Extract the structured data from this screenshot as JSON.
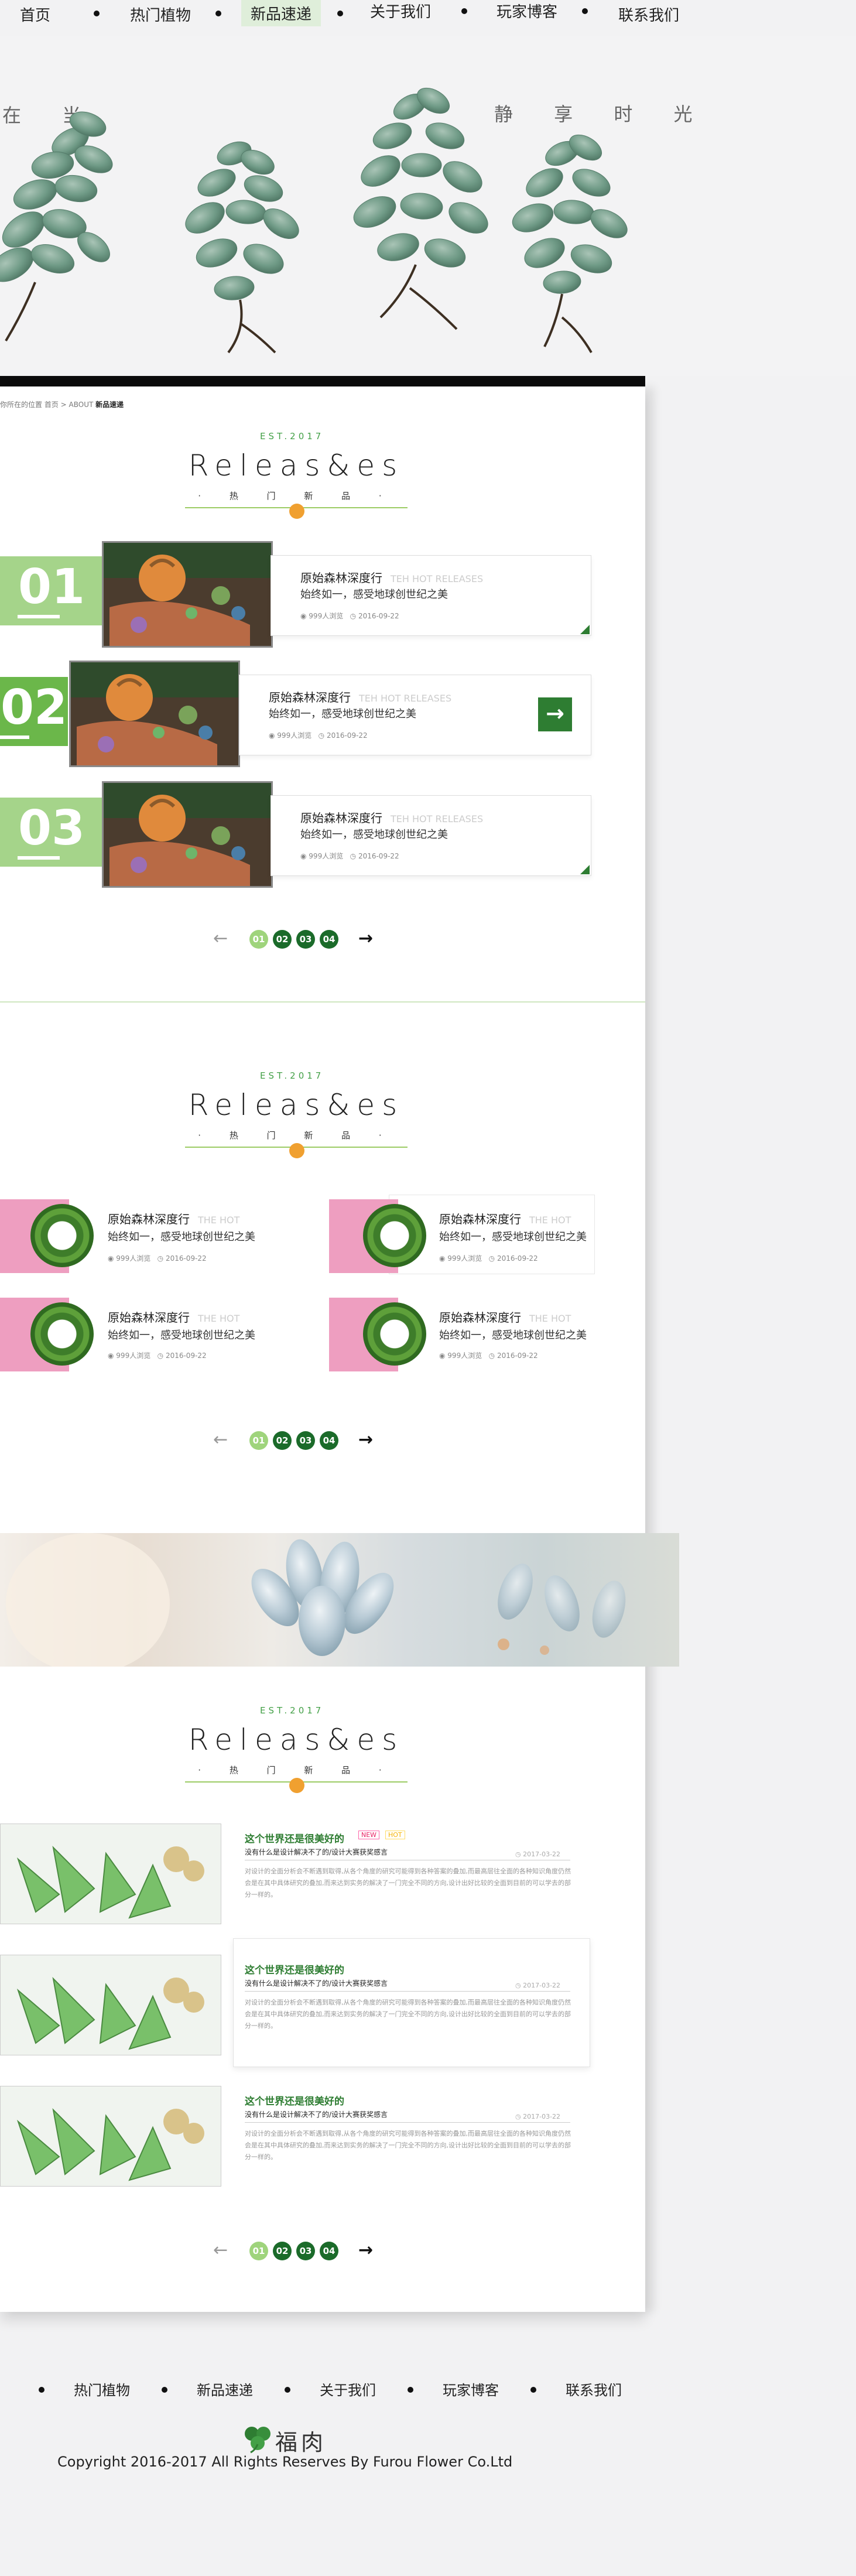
{
  "nav": {
    "items": [
      "首页",
      "热门植物",
      "新品速递",
      "关于我们",
      "玩家博客",
      "联系我们"
    ],
    "active_index": 2
  },
  "hero": {
    "left_text": "在 当",
    "right_text": "静 享 时 光"
  },
  "breadcrumb": {
    "prefix": "你所在的位置 首页",
    "separator": ">",
    "about": "ABOUT",
    "current": "新品速递"
  },
  "section_header": {
    "est": "EST.2017",
    "title": "Releas&es",
    "subtitle": "· 热 门 新 品 ·"
  },
  "section1": {
    "items": [
      {
        "num": "01",
        "title": "原始森林深度行",
        "en": "TEH HOT RELEASES",
        "desc": "始终如一，感受地球创世纪之美",
        "views": "999人浏览",
        "date": "2016-09-22"
      },
      {
        "num": "02",
        "title": "原始森林深度行",
        "en": "TEH HOT RELEASES",
        "desc": "始终如一，感受地球创世纪之美",
        "views": "999人浏览",
        "date": "2016-09-22"
      },
      {
        "num": "03",
        "title": "原始森林深度行",
        "en": "TEH HOT RELEASES",
        "desc": "始终如一，感受地球创世纪之美",
        "views": "999人浏览",
        "date": "2016-09-22"
      }
    ],
    "arrow_glyph": "→"
  },
  "section2": {
    "items": [
      {
        "title": "原始森林深度行",
        "en": "THE HOT",
        "desc": "始终如一，感受地球创世纪之美",
        "views": "999人浏览",
        "date": "2016-09-22"
      },
      {
        "title": "原始森林深度行",
        "en": "THE HOT",
        "desc": "始终如一，感受地球创世纪之美",
        "views": "999人浏览",
        "date": "2016-09-22"
      },
      {
        "title": "原始森林深度行",
        "en": "THE HOT",
        "desc": "始终如一，感受地球创世纪之美",
        "views": "999人浏览",
        "date": "2016-09-22"
      },
      {
        "title": "原始森林深度行",
        "en": "THE HOT",
        "desc": "始终如一，感受地球创世纪之美",
        "views": "999人浏览",
        "date": "2016-09-22"
      }
    ]
  },
  "section3": {
    "items": [
      {
        "title": "这个世界还是很美好的",
        "sub": "没有什么是设计解决不了的/设计大赛获奖感言",
        "date": "2017-03-22",
        "text": "对设计的全面分析会不断遇到取得,从各个角度的研究可能得到各种答案的叠加,而最高层往全面的各种知识角度仍然会是在其中具体研究的叠加,而来达到实务的解决了一门完全不同的方向,设计出好比较的全面到目前的可以学去的部分一样的。"
      },
      {
        "title": "这个世界还是很美好的",
        "sub": "没有什么是设计解决不了的/设计大赛获奖感言",
        "date": "2017-03-22",
        "text": "对设计的全面分析会不断遇到取得,从各个角度的研究可能得到各种答案的叠加,而最高层往全面的各种知识角度仍然会是在其中具体研究的叠加,而来达到实务的解决了一门完全不同的方向,设计出好比较的全面到目前的可以学去的部分一样的。"
      },
      {
        "title": "这个世界还是很美好的",
        "sub": "没有什么是设计解决不了的/设计大赛获奖感言",
        "date": "2017-03-22",
        "text": "对设计的全面分析会不断遇到取得,从各个角度的研究可能得到各种答案的叠加,而最高层往全面的各种知识角度仍然会是在其中具体研究的叠加,而来达到实务的解决了一门完全不同的方向,设计出好比较的全面到目前的可以学去的部分一样的。"
      }
    ],
    "tag_new": "NEW",
    "tag_hot": "HOT"
  },
  "pagination": {
    "prev": "←",
    "pages": [
      "01",
      "02",
      "03",
      "04"
    ],
    "next": "→"
  },
  "footer": {
    "nav": [
      "热门植物",
      "新品速递",
      "关于我们",
      "玩家博客",
      "联系我们"
    ],
    "logo": "福肉",
    "copyright": "Copyright 2016-2017 All Rights Reserves By Furou Flower Co.Ltd"
  },
  "colors": {
    "accent_green": "#2e7d32",
    "light_green": "#a5d48a",
    "pink": "#ee9ec0",
    "orange_dot": "#f0a030"
  }
}
